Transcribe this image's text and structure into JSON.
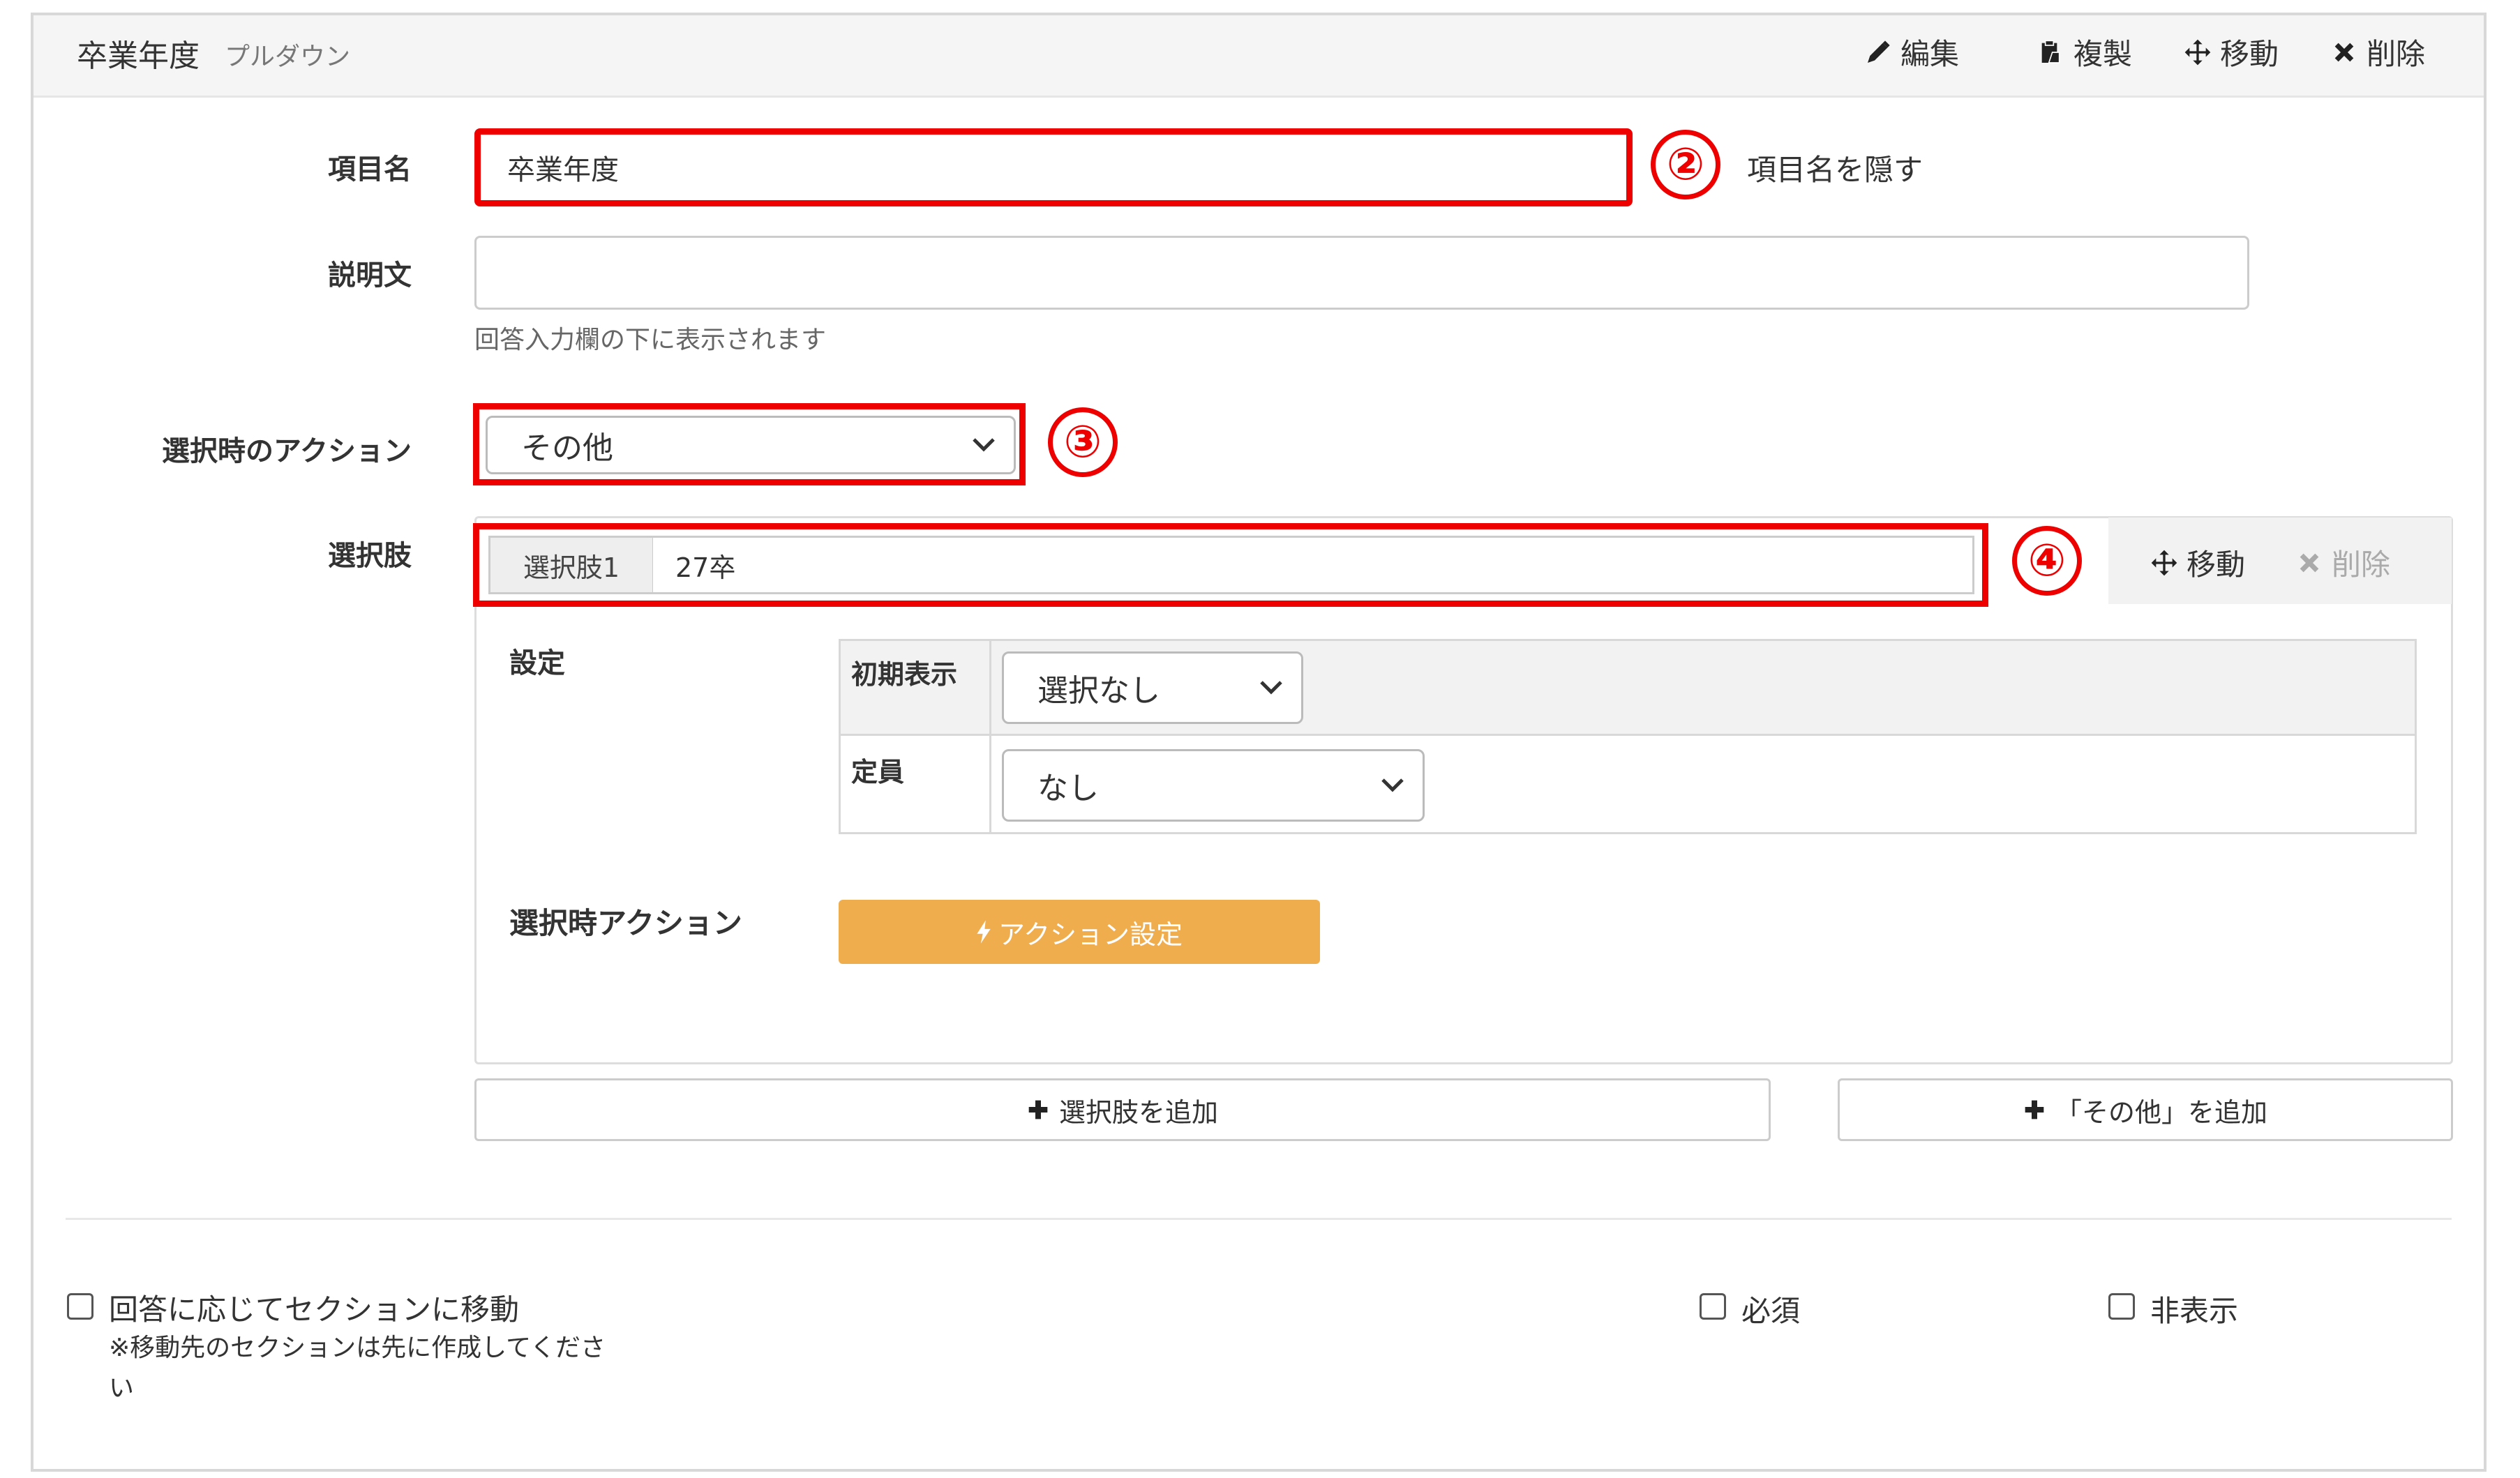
{
  "header": {
    "title": "卒業年度",
    "subtitle": "プルダウン",
    "actions": {
      "edit": "編集",
      "duplicate": "複製",
      "move": "移動",
      "delete": "削除"
    }
  },
  "form": {
    "item_name": {
      "label": "項目名",
      "value": "卒業年度",
      "hide_label": "項目名を隠す",
      "marker": "②"
    },
    "description": {
      "label": "説明文",
      "value": "",
      "help": "回答入力欄の下に表示されます"
    },
    "action_on_select": {
      "label": "選択時のアクション",
      "selected": "その他",
      "marker": "③"
    },
    "choices": {
      "label": "選択肢",
      "marker": "④",
      "items": [
        {
          "tag": "選択肢1",
          "value": "27卒",
          "move": "移動",
          "delete": "削除",
          "settings": {
            "label": "設定",
            "initial_display_label": "初期表示",
            "initial_display_value": "選択なし",
            "capacity_label": "定員",
            "capacity_value": "なし"
          },
          "action": {
            "label": "選択時アクション",
            "button": "アクション設定"
          }
        }
      ],
      "add_choice": "選択肢を追加",
      "add_other": "「その他」を追加"
    }
  },
  "footer": {
    "section_move": {
      "label": "回答に応じてセクションに移動",
      "note": "※移動先のセクションは先に作成してください"
    },
    "required": "必須",
    "hidden": "非表示"
  },
  "colors": {
    "accent_red": "#ee0000",
    "action_button": "#f0ad4e"
  }
}
